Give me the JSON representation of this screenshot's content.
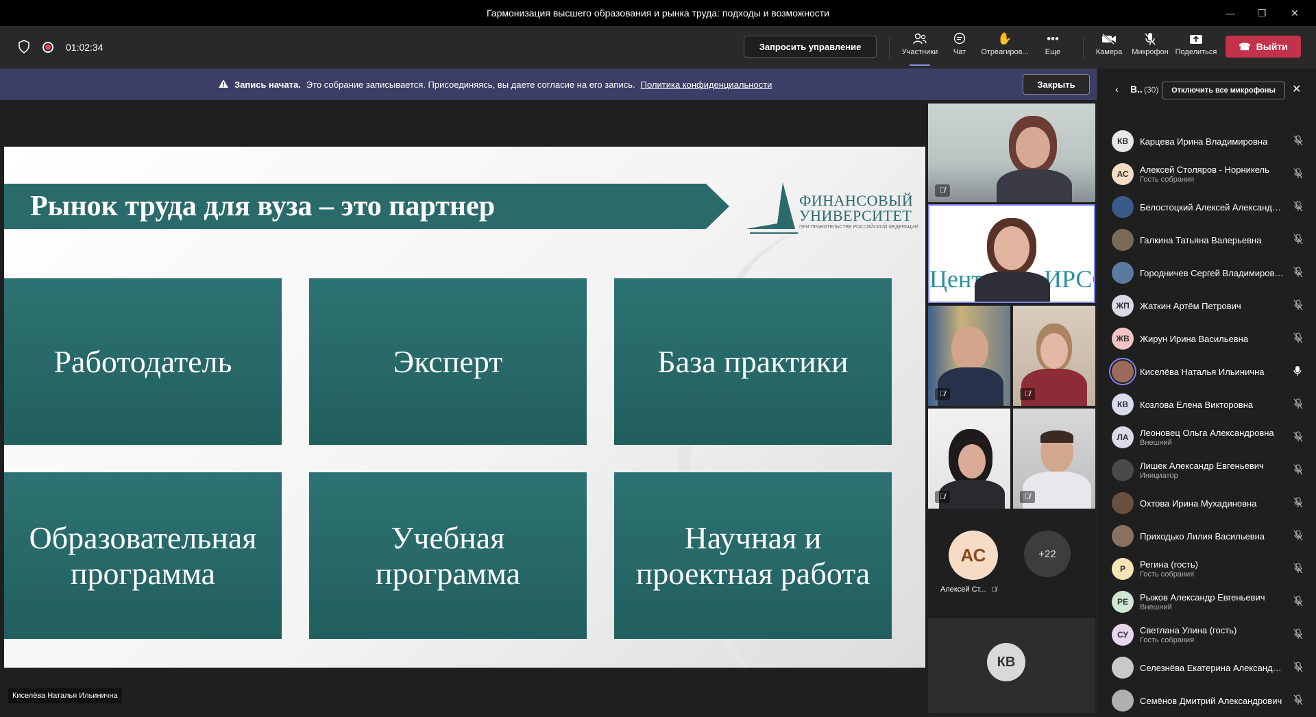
{
  "window": {
    "title": "Гармонизация высшего образования и рынка труда: подходы и возможности"
  },
  "toolbar": {
    "timer": "01:02:34",
    "request_control": "Запросить управление",
    "items": [
      {
        "label": "Участники",
        "icon": "people-icon"
      },
      {
        "label": "Чат",
        "icon": "chat-icon"
      },
      {
        "label": "Отреагиров...",
        "icon": "hand-icon"
      },
      {
        "label": "Еще",
        "icon": "more-icon"
      },
      {
        "label": "Камера",
        "icon": "camera-off-icon"
      },
      {
        "label": "Микрофон",
        "icon": "mic-off-icon"
      },
      {
        "label": "Поделиться",
        "icon": "share-icon"
      }
    ],
    "leave": "Выйти",
    "leave_color": "#c4314b"
  },
  "banner": {
    "bold": "Запись начата.",
    "text": "Это собрание записывается. Присоединяясь, вы даете согласие на его запись.",
    "link": "Политика конфиденциальности",
    "close": "Закрыть",
    "background": "#3d3e66"
  },
  "slide": {
    "title": "Рынок труда для вуза – это партнер",
    "logo_line1": "ФИНАНСОВЫЙ",
    "logo_line2": "УНИВЕРСИТЕТ",
    "logo_sub": "ПРИ ПРАВИТЕЛЬСТВЕ РОССИЙСКОЙ ФЕДЕРАЦИИ",
    "tiles": [
      "Работодатель",
      "Эксперт",
      "База практики",
      "Образовательная программа",
      "Учебная программа",
      "Научная и проектная работа"
    ],
    "accent": "#2b6a6a"
  },
  "presenter_name": "Киселёва Наталья Ильинична",
  "videos": {
    "tile2_text": "Цент          ИРСО",
    "avatar_as_initials": "АС",
    "avatar_as_name": "Алексей Ст...",
    "more_count": "+22",
    "avatar_kv_initials": "КВ"
  },
  "panel": {
    "title": "В..",
    "count": "(30)",
    "mute_all": "Отключить все микрофоны",
    "participants": [
      {
        "initials": "КВ",
        "name": "Карцева Ирина Владимировна",
        "sub": "",
        "avatar_color": "#e8e8e8",
        "mic": "off"
      },
      {
        "initials": "АС",
        "name": "Алексей Столяров - Норникель",
        "sub": "Гость собрания",
        "avatar_color": "#f6dcc5",
        "mic": "off"
      },
      {
        "initials": "",
        "name": "Белостоцкий Алексей Александрович",
        "sub": "",
        "avatar_color": "#3a5b8a",
        "mic": "off"
      },
      {
        "initials": "",
        "name": "Галкина Татьяна Валерьевна",
        "sub": "",
        "avatar_color": "#7a6a5a",
        "mic": "off"
      },
      {
        "initials": "",
        "name": "Городничев Сергей Владимирович",
        "sub": "",
        "avatar_color": "#5c7aa0",
        "mic": "off"
      },
      {
        "initials": "ЖП",
        "name": "Жаткин Артём Петрович",
        "sub": "",
        "avatar_color": "#d9d9e8",
        "mic": "off"
      },
      {
        "initials": "ЖВ",
        "name": "Жирун Ирина Васильевна",
        "sub": "",
        "avatar_color": "#f3c4c4",
        "mic": "off"
      },
      {
        "initials": "",
        "name": "Киселёва Наталья Ильинична",
        "sub": "",
        "avatar_color": "#9a6b5a",
        "mic": "on"
      },
      {
        "initials": "КВ",
        "name": "Козлова Елена Викторовна",
        "sub": "",
        "avatar_color": "#d9dcef",
        "mic": "off"
      },
      {
        "initials": "ЛА",
        "name": "Леоновец Ольга Александровна",
        "sub": "Внешний",
        "avatar_color": "#d9d9e8",
        "mic": "off"
      },
      {
        "initials": "",
        "name": "Лишек Александр Евгеньевич",
        "sub": "Инициатор",
        "avatar_color": "#4a4a4a",
        "mic": "off"
      },
      {
        "initials": "",
        "name": "Охтова Ирина Мухадиновна",
        "sub": "",
        "avatar_color": "#6a5040",
        "mic": "off"
      },
      {
        "initials": "",
        "name": "Приходько Лилия Васильевна",
        "sub": "",
        "avatar_color": "#8a7060",
        "mic": "off"
      },
      {
        "initials": "Р",
        "name": "Регина (гость)",
        "sub": "Гость собрания",
        "avatar_color": "#f7e6b5",
        "mic": "off"
      },
      {
        "initials": "РЕ",
        "name": "Рыжов Александр Евгеньевич",
        "sub": "Внешний",
        "avatar_color": "#cfe8d5",
        "mic": "off"
      },
      {
        "initials": "СУ",
        "name": "Светлана Улина (гость)",
        "sub": "Гость собрания",
        "avatar_color": "#e8d6ef",
        "mic": "off"
      },
      {
        "initials": "",
        "name": "Селезнёва Екатерина Александровна",
        "sub": "",
        "avatar_color": "#c9c9c9",
        "mic": "off"
      },
      {
        "initials": "",
        "name": "Семёнов Дмитрий Александрович",
        "sub": "",
        "avatar_color": "#b0b0b0",
        "mic": "off"
      }
    ]
  }
}
